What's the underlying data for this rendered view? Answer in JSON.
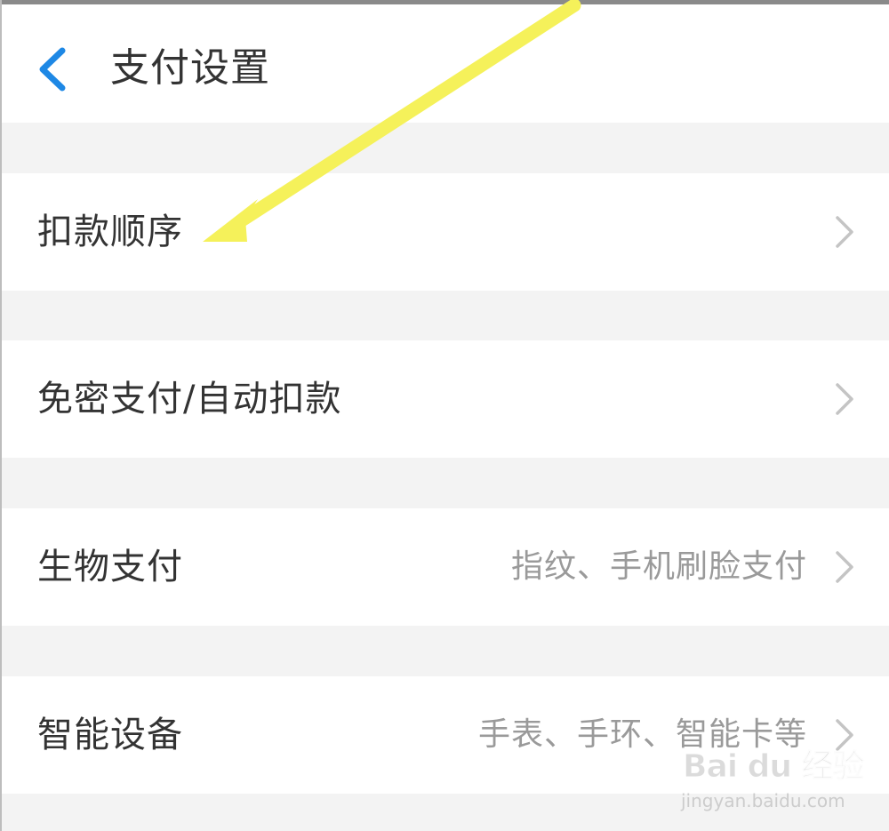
{
  "header": {
    "back_icon": "chevron-left-icon",
    "title": "支付设置",
    "accent_color": "#1e88e5"
  },
  "settings": {
    "items": [
      {
        "label": "扣款顺序",
        "detail": ""
      },
      {
        "label": "免密支付/自动扣款",
        "detail": ""
      },
      {
        "label": "生物支付",
        "detail": "指纹、手机刷脸支付"
      },
      {
        "label": "智能设备",
        "detail": "手表、手环、智能卡等"
      }
    ],
    "chevron_icon": "chevron-right-icon"
  },
  "annotation": {
    "arrow_icon": "arrow-pointer-icon",
    "arrow_color": "#f5f15a",
    "points_to": "扣款顺序"
  },
  "watermark": {
    "logo": "Bai du 经验",
    "url": "jingyan.baidu.com"
  }
}
